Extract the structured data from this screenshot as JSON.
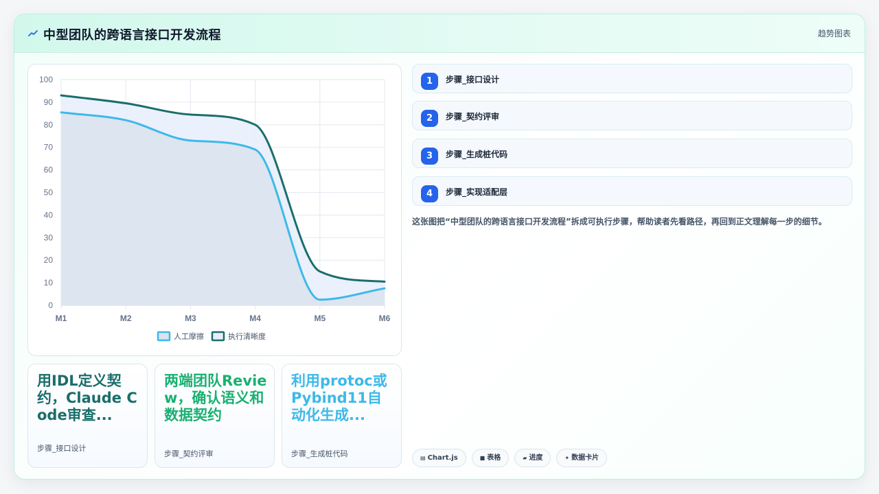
{
  "header": {
    "title": "中型团队的跨语言接口开发流程",
    "tag": "趋势图表"
  },
  "chart_data": {
    "type": "line",
    "categories": [
      "M1",
      "M2",
      "M3",
      "M4",
      "M5",
      "M6"
    ],
    "series": [
      {
        "name": "人工摩擦",
        "values": [
          85.5,
          82,
          73,
          69,
          2.5,
          7.5
        ],
        "color": "#3db9e8",
        "fill": "#dbe3ee"
      },
      {
        "name": "执行清晰度",
        "values": [
          93,
          89.5,
          84.5,
          80,
          15,
          10.5
        ],
        "color": "#1a6e6a",
        "fill": "#e8eefc"
      }
    ],
    "ylim": [
      0,
      100
    ],
    "yticks": [
      0,
      10,
      20,
      30,
      40,
      50,
      60,
      70,
      80,
      90,
      100
    ],
    "grid": true,
    "legend": "bottom"
  },
  "mini_cards": [
    {
      "title": "用IDL定义契约，Claude Code审查...",
      "subtitle": "步骤_接口设计",
      "color": "#1a6e6a"
    },
    {
      "title": "两端团队Review，确认语义和数据契约",
      "subtitle": "步骤_契约评审",
      "color": "#19b071"
    },
    {
      "title": "利用protoc或Pybind11自动化生成...",
      "subtitle": "步骤_生成桩代码",
      "color": "#3db9e8"
    }
  ],
  "steps": [
    {
      "num": "1",
      "label": "步骤_接口设计"
    },
    {
      "num": "2",
      "label": "步骤_契约评审"
    },
    {
      "num": "3",
      "label": "步骤_生成桩代码"
    },
    {
      "num": "4",
      "label": "步骤_实现适配层"
    }
  ],
  "description": "这张图把“中型团队的跨语言接口开发流程”拆成可执行步骤，帮助读者先看路径，再回到正文理解每一步的细节。",
  "chips": [
    {
      "icon": "▤",
      "icon_name": "chart-icon",
      "label": "Chart.js"
    },
    {
      "icon": "■",
      "icon_name": "table-icon",
      "label": "表格"
    },
    {
      "icon": "▰",
      "icon_name": "progress-icon",
      "label": "进度"
    },
    {
      "icon": "✦",
      "icon_name": "sparkle-icon",
      "label": "数据卡片"
    }
  ]
}
